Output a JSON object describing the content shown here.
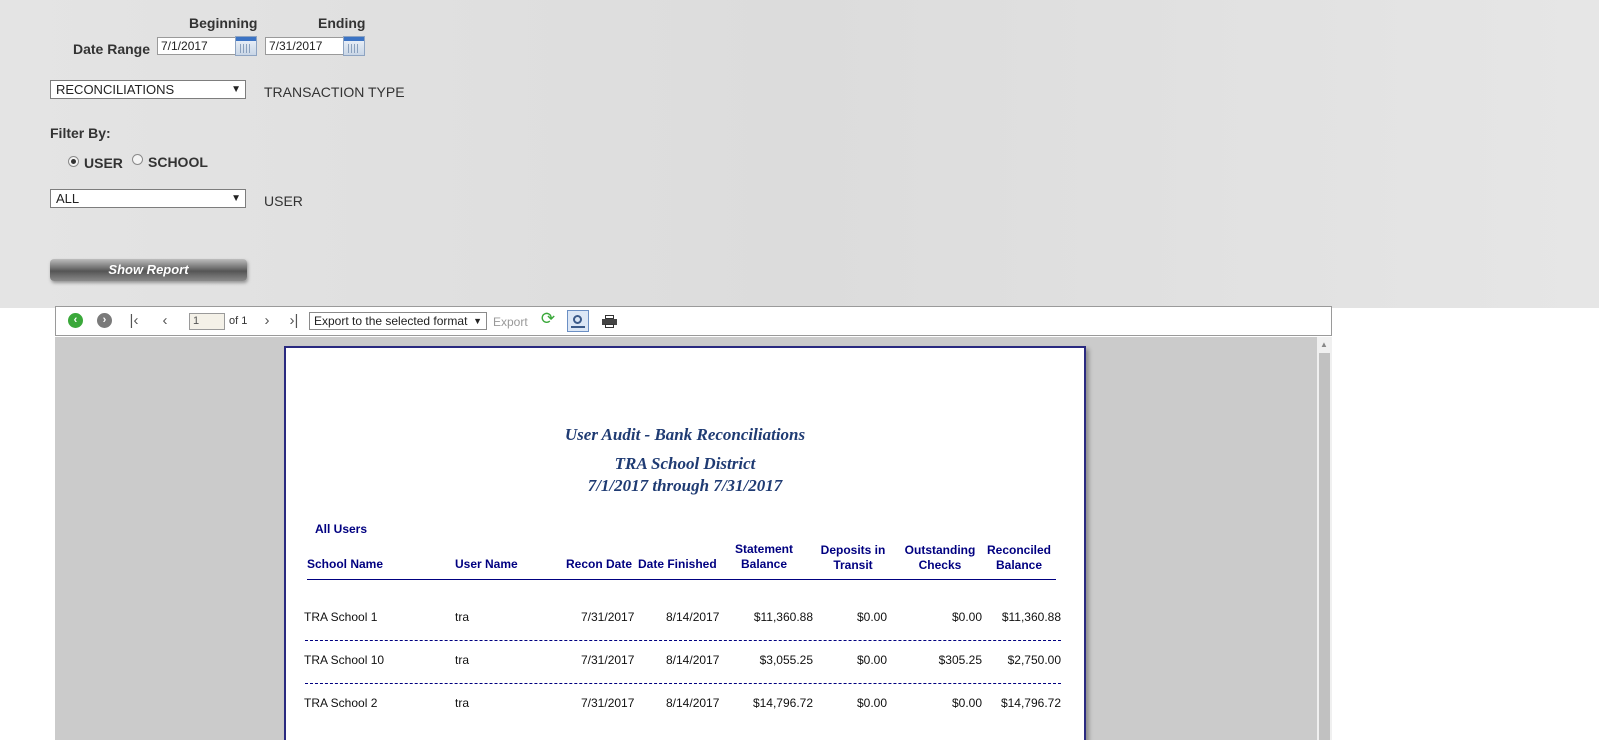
{
  "filters": {
    "beginning_label": "Beginning",
    "ending_label": "Ending",
    "date_range_label": "Date Range",
    "begin_date": "7/1/2017",
    "end_date": "7/31/2017",
    "transaction_type_value": "RECONCILIATIONS",
    "transaction_type_label": "TRANSACTION TYPE",
    "filter_by_label": "Filter By:",
    "radio_user_label": "USER",
    "radio_school_label": "SCHOOL",
    "user_value": "ALL",
    "user_label": "USER",
    "show_report_label": "Show Report"
  },
  "toolbar": {
    "page_value": "1",
    "of_pages": "of 1",
    "export_format": "Export to the selected format",
    "export_label": "Export"
  },
  "report": {
    "title": "User Audit  -  Bank Reconciliations",
    "district": "TRA School District",
    "date_range": "7/1/2017  through  7/31/2017",
    "group_label": "All Users",
    "columns": {
      "school_name": "School Name",
      "user_name": "User Name",
      "recon_date": "Recon Date",
      "date_finished": "Date Finished",
      "statement_balance_1": "Statement",
      "statement_balance_2": "Balance",
      "deposits_1": "Deposits in",
      "deposits_2": "Transit",
      "outstanding_1": "Outstanding",
      "outstanding_2": "Checks",
      "reconciled_1": "Reconciled",
      "reconciled_2": "Balance"
    },
    "rows": [
      {
        "school": "TRA School 1",
        "user": "tra",
        "recon_date": "7/31/2017",
        "date_finished": "8/14/2017",
        "statement_balance": "$11,360.88",
        "deposits": "$0.00",
        "outstanding": "$0.00",
        "reconciled": "$11,360.88"
      },
      {
        "school": "TRA School 10",
        "user": "tra",
        "recon_date": "7/31/2017",
        "date_finished": "8/14/2017",
        "statement_balance": "$3,055.25",
        "deposits": "$0.00",
        "outstanding": "$305.25",
        "reconciled": "$2,750.00"
      },
      {
        "school": "TRA School 2",
        "user": "tra",
        "recon_date": "7/31/2017",
        "date_finished": "8/14/2017",
        "statement_balance": "$14,796.72",
        "deposits": "$0.00",
        "outstanding": "$0.00",
        "reconciled": "$14,796.72"
      }
    ]
  }
}
